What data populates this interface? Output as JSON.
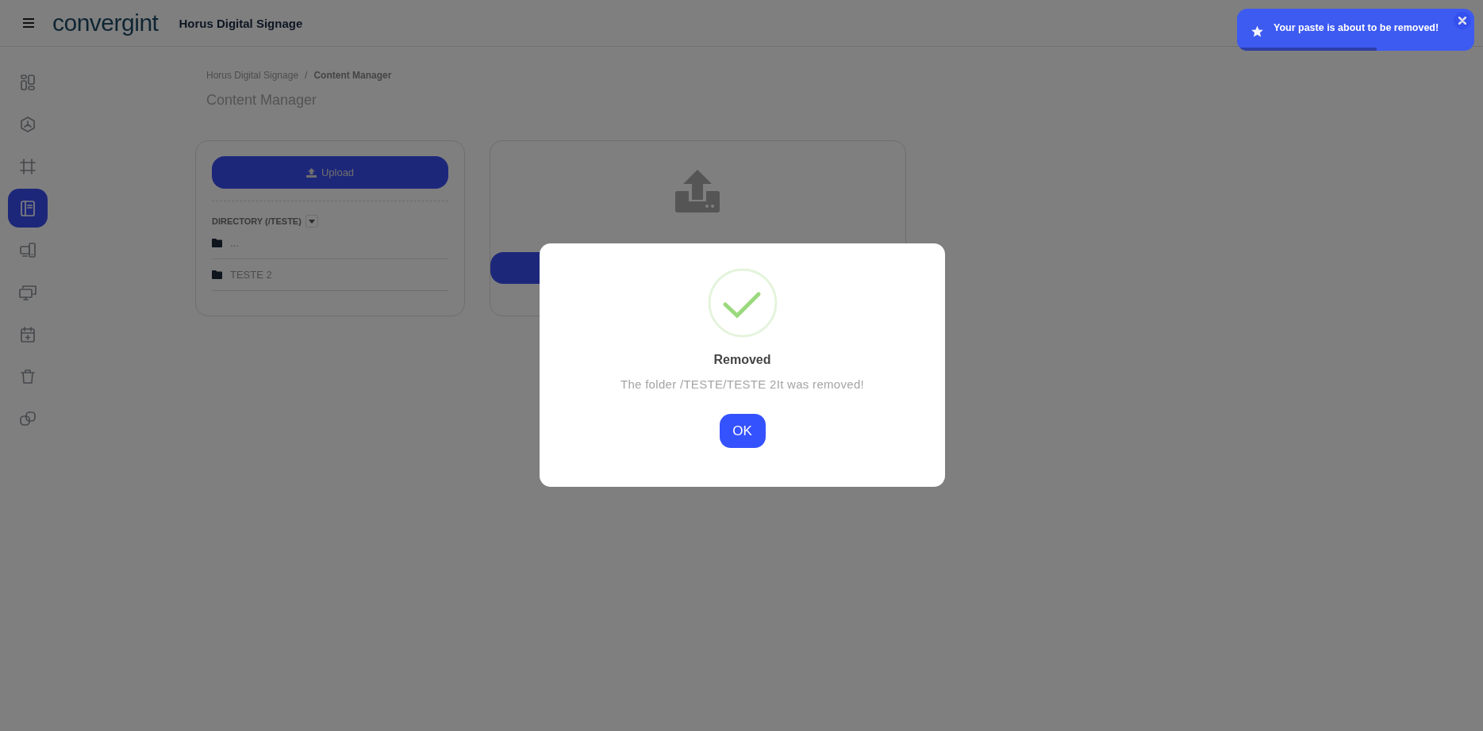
{
  "header": {
    "logo": "convergint",
    "app_title": "Horus Digital Signage"
  },
  "sidebar": {
    "items": [
      {
        "selected": false
      },
      {
        "selected": false
      },
      {
        "selected": false
      },
      {
        "selected": true
      },
      {
        "selected": false
      },
      {
        "selected": false
      },
      {
        "selected": false
      },
      {
        "selected": false
      },
      {
        "selected": false
      }
    ]
  },
  "breadcrumb": {
    "separator": "/",
    "items": [
      {
        "label": "Horus Digital Signage",
        "current": false
      },
      {
        "label": "Content Manager",
        "current": true
      }
    ]
  },
  "page_title": "Content Manager",
  "file_panel": {
    "upload_button": "Upload",
    "directory_label": "DIRECTORY (/TESTE)",
    "entries": [
      {
        "name": "..."
      },
      {
        "name": "TESTE 2"
      }
    ]
  },
  "dialog": {
    "title": "Removed",
    "message": "The folder /TESTE/TESTE 2It was removed!",
    "button": "OK"
  },
  "toast": {
    "message": "Your paste is about to be removed!",
    "progress": {
      "level": 0.59
    }
  }
}
